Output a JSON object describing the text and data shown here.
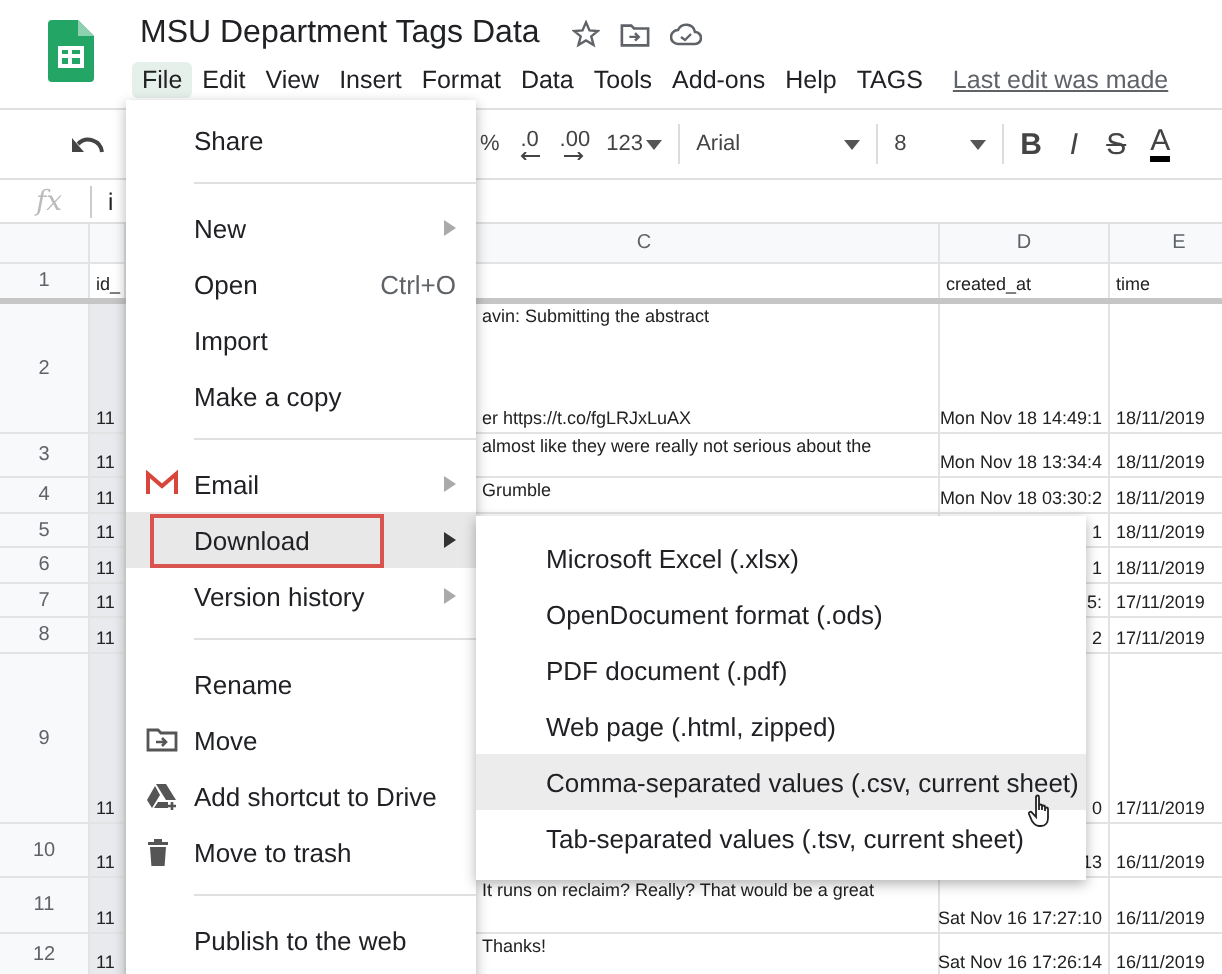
{
  "doc": {
    "title": "MSU Department Tags Data"
  },
  "menu_bar": [
    {
      "label": "File",
      "selected": true
    },
    {
      "label": "Edit",
      "selected": false
    },
    {
      "label": "View",
      "selected": false
    },
    {
      "label": "Insert",
      "selected": false
    },
    {
      "label": "Format",
      "selected": false
    },
    {
      "label": "Data",
      "selected": false
    },
    {
      "label": "Tools",
      "selected": false
    },
    {
      "label": "Add-ons",
      "selected": false
    },
    {
      "label": "Help",
      "selected": false
    },
    {
      "label": "TAGS",
      "selected": false
    }
  ],
  "last_edit": "Last edit was made",
  "toolbar": {
    "percent": "%",
    "decimal_less": ".0",
    "decimal_more": ".00",
    "number_format": "123",
    "font": "Arial",
    "font_size": "8",
    "bold": "B",
    "italic": "I",
    "strikethrough": "S",
    "text_color": "A"
  },
  "formula_bar": {
    "label": "fx",
    "value": "i"
  },
  "columns": [
    "C",
    "D",
    "E"
  ],
  "rows": [
    {
      "number": "1",
      "a": "id_",
      "c": [],
      "d": "created_at",
      "e": "time"
    },
    {
      "number": "2",
      "a": "11",
      "c": [
        "avin: Submitting the abstract",
        "er https://t.co/fgLRJxLuAX"
      ],
      "d": "Mon Nov 18 14:49:1",
      "e": "18/11/2019"
    },
    {
      "number": "3",
      "a": "11",
      "c": [
        "almost like they were really not serious about the"
      ],
      "d": "Mon Nov 18 13:34:4",
      "e": "18/11/2019"
    },
    {
      "number": "4",
      "a": "11",
      "c": [
        "Grumble"
      ],
      "d": "Mon Nov 18 03:30:2",
      "e": "18/11/2019"
    },
    {
      "number": "5",
      "a": "11",
      "c": [],
      "d": "1",
      "e": "18/11/2019"
    },
    {
      "number": "6",
      "a": "11",
      "c": [],
      "d": "1",
      "e": "18/11/2019"
    },
    {
      "number": "7",
      "a": "11",
      "c": [],
      "d": "5:",
      "e": "17/11/2019"
    },
    {
      "number": "8",
      "a": "11",
      "c": [],
      "d": "2",
      "e": "17/11/2019"
    },
    {
      "number": "9",
      "a": "11",
      "c": [],
      "d": "0",
      "e": "17/11/2019"
    },
    {
      "number": "10",
      "a": "11",
      "c": [],
      "d": "13",
      "e": "16/11/2019"
    },
    {
      "number": "11",
      "a": "11",
      "c": [
        "It runs on reclaim? Really? That would be a great"
      ],
      "d": "Sat Nov 16 17:27:10",
      "e": "16/11/2019"
    },
    {
      "number": "12",
      "a": "11",
      "c": [
        "Thanks!"
      ],
      "d": "Sat Nov 16 17:26:14",
      "e": "16/11/2019"
    }
  ],
  "file_menu": [
    {
      "kind": "item",
      "label": "Share",
      "submenu": false,
      "selected": false
    },
    {
      "kind": "divider"
    },
    {
      "kind": "item",
      "label": "New",
      "submenu": true,
      "selected": false
    },
    {
      "kind": "item",
      "label": "Open",
      "shortcut": "Ctrl+O",
      "submenu": false,
      "selected": false
    },
    {
      "kind": "item",
      "label": "Import",
      "submenu": false,
      "selected": false
    },
    {
      "kind": "item",
      "label": "Make a copy",
      "submenu": false,
      "selected": false
    },
    {
      "kind": "divider"
    },
    {
      "kind": "item",
      "label": "Email",
      "submenu": true,
      "selected": false
    },
    {
      "kind": "item",
      "label": "Download",
      "submenu": true,
      "selected": true
    },
    {
      "kind": "item",
      "label": "Version history",
      "submenu": true,
      "selected": false
    },
    {
      "kind": "divider"
    },
    {
      "kind": "item",
      "label": "Rename",
      "submenu": false,
      "selected": false
    },
    {
      "kind": "item",
      "label": "Move",
      "submenu": false,
      "selected": false
    },
    {
      "kind": "item",
      "label": "Add shortcut to Drive",
      "submenu": false,
      "selected": false
    },
    {
      "kind": "item",
      "label": "Move to trash",
      "submenu": false,
      "selected": false
    },
    {
      "kind": "divider"
    },
    {
      "kind": "item",
      "label": "Publish to the web",
      "submenu": false,
      "selected": false
    }
  ],
  "download_menu": [
    {
      "label": "Microsoft Excel (.xlsx)",
      "selected": false
    },
    {
      "label": "OpenDocument format (.ods)",
      "selected": false
    },
    {
      "label": "PDF document (.pdf)",
      "selected": false
    },
    {
      "label": "Web page (.html, zipped)",
      "selected": false
    },
    {
      "label": "Comma-separated values (.csv, current sheet)",
      "selected": true
    },
    {
      "label": "Tab-separated values (.tsv, current sheet)",
      "selected": false
    }
  ]
}
